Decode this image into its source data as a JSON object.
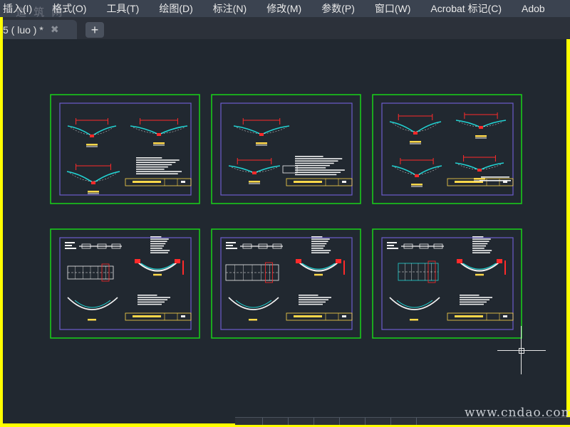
{
  "menubar": {
    "items": [
      "插入(I)",
      "格式(O)",
      "工具(T)",
      "绘图(D)",
      "标注(N)",
      "修改(M)",
      "参数(P)",
      "窗口(W)",
      "Acrobat 标记(C)",
      "Adob"
    ]
  },
  "tabs": {
    "active_label": "5 ( luo ) *",
    "close_glyph": "✖",
    "new_tab_glyph": "+"
  },
  "watermarks": {
    "top": "道 筑 网",
    "bottom": "www.cndao.com"
  },
  "colors": {
    "frame": "#19d219",
    "inner_frame": "#6c5ccc",
    "water": "#22d3d3",
    "highlight": "#ffd84a",
    "dimension": "#ff2a2a",
    "text": "#f2f2f2",
    "canvas": "#212830"
  },
  "sheets": [
    {
      "kind": "channel-3"
    },
    {
      "kind": "channel-slope"
    },
    {
      "kind": "channel-4"
    },
    {
      "kind": "detail-a"
    },
    {
      "kind": "detail-b"
    },
    {
      "kind": "detail-c"
    }
  ]
}
